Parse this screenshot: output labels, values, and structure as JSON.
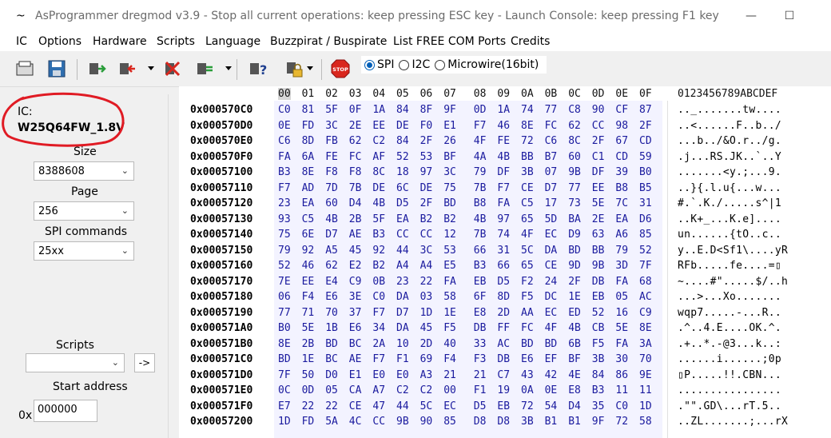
{
  "window": {
    "title": "AsProgrammer dregmod v3.9 - Stop all current operations: keep pressing ESC key - Launch Console: keep pressing F1 key",
    "app_icon": "~",
    "minimize": "—",
    "maximize": "☐"
  },
  "menu": [
    "IC",
    "Options",
    "Hardware",
    "Scripts",
    "Language",
    "Buzzpirat / Buspirate",
    "List FREE COM Ports",
    "Credits"
  ],
  "toolbar": {
    "icons": [
      "open-folder-icon",
      "save-icon",
      "read-chip-icon",
      "write-chip-icon",
      "erase-chip-icon",
      "verify-chip-icon",
      "read-id-icon",
      "lock-icon",
      "stop-icon"
    ],
    "stop_label": "STOP"
  },
  "protocol": {
    "options": [
      "SPI",
      "I2C",
      "Microwire(16bit)"
    ],
    "selected": "SPI"
  },
  "left": {
    "ic_label": "IC:",
    "ic_name": "W25Q64FW_1.8V",
    "size_label": "Size",
    "size_value": "8388608",
    "page_label": "Page",
    "page_value": "256",
    "spi_label": "SPI commands",
    "spi_value": "25xx",
    "scripts_label": "Scripts",
    "scripts_value": "",
    "run_button": "->",
    "start_label": "Start address",
    "start_prefix": "0x",
    "start_value": "000000"
  },
  "hex": {
    "columns": [
      "00",
      "01",
      "02",
      "03",
      "04",
      "05",
      "06",
      "07",
      "08",
      "09",
      "0A",
      "0B",
      "0C",
      "0D",
      "0E",
      "0F"
    ],
    "ascii_header": "0123456789ABCDEF",
    "rows": [
      {
        "addr": "0x000570C0",
        "bytes": [
          "C0",
          "81",
          "5F",
          "0F",
          "1A",
          "84",
          "8F",
          "9F",
          "0D",
          "1A",
          "74",
          "77",
          "C8",
          "90",
          "CF",
          "87"
        ],
        "ascii": ".._.......tw...."
      },
      {
        "addr": "0x000570D0",
        "bytes": [
          "0E",
          "FD",
          "3C",
          "2E",
          "EE",
          "DE",
          "F0",
          "E1",
          "F7",
          "46",
          "8E",
          "FC",
          "62",
          "CC",
          "98",
          "2F"
        ],
        "ascii": "..<......F..b../"
      },
      {
        "addr": "0x000570E0",
        "bytes": [
          "C6",
          "8D",
          "FB",
          "62",
          "C2",
          "84",
          "2F",
          "26",
          "4F",
          "FE",
          "72",
          "C6",
          "8C",
          "2F",
          "67",
          "CD"
        ],
        "ascii": "...b../&O.r../g."
      },
      {
        "addr": "0x000570F0",
        "bytes": [
          "FA",
          "6A",
          "FE",
          "FC",
          "AF",
          "52",
          "53",
          "BF",
          "4A",
          "4B",
          "BB",
          "B7",
          "60",
          "C1",
          "CD",
          "59"
        ],
        "ascii": ".j...RS.JK..`..Y"
      },
      {
        "addr": "0x00057100",
        "bytes": [
          "B3",
          "8E",
          "F8",
          "F8",
          "8C",
          "18",
          "97",
          "3C",
          "79",
          "DF",
          "3B",
          "07",
          "9B",
          "DF",
          "39",
          "B0"
        ],
        "ascii": ".......<y.;...9."
      },
      {
        "addr": "0x00057110",
        "bytes": [
          "F7",
          "AD",
          "7D",
          "7B",
          "DE",
          "6C",
          "DE",
          "75",
          "7B",
          "F7",
          "CE",
          "D7",
          "77",
          "EE",
          "B8",
          "B5"
        ],
        "ascii": "..}{.l.u{...w..."
      },
      {
        "addr": "0x00057120",
        "bytes": [
          "23",
          "EA",
          "60",
          "D4",
          "4B",
          "D5",
          "2F",
          "BD",
          "B8",
          "FA",
          "C5",
          "17",
          "73",
          "5E",
          "7C",
          "31"
        ],
        "ascii": "#.`.K./.....s^|1"
      },
      {
        "addr": "0x00057130",
        "bytes": [
          "93",
          "C5",
          "4B",
          "2B",
          "5F",
          "EA",
          "B2",
          "B2",
          "4B",
          "97",
          "65",
          "5D",
          "BA",
          "2E",
          "EA",
          "D6"
        ],
        "ascii": "..K+_...K.e]...."
      },
      {
        "addr": "0x00057140",
        "bytes": [
          "75",
          "6E",
          "D7",
          "AE",
          "B3",
          "CC",
          "CC",
          "12",
          "7B",
          "74",
          "4F",
          "EC",
          "D9",
          "63",
          "A6",
          "85"
        ],
        "ascii": "un......{tO..c.."
      },
      {
        "addr": "0x00057150",
        "bytes": [
          "79",
          "92",
          "A5",
          "45",
          "92",
          "44",
          "3C",
          "53",
          "66",
          "31",
          "5C",
          "DA",
          "BD",
          "BB",
          "79",
          "52"
        ],
        "ascii": "y..E.D<Sf1\\....yR"
      },
      {
        "addr": "0x00057160",
        "bytes": [
          "52",
          "46",
          "62",
          "E2",
          "B2",
          "A4",
          "A4",
          "E5",
          "B3",
          "66",
          "65",
          "CE",
          "9D",
          "9B",
          "3D",
          "7F"
        ],
        "ascii": "RFb.....fe....=▯"
      },
      {
        "addr": "0x00057170",
        "bytes": [
          "7E",
          "EE",
          "E4",
          "C9",
          "0B",
          "23",
          "22",
          "FA",
          "EB",
          "D5",
          "F2",
          "24",
          "2F",
          "DB",
          "FA",
          "68"
        ],
        "ascii": "~....#\".....$/..h"
      },
      {
        "addr": "0x00057180",
        "bytes": [
          "06",
          "F4",
          "E6",
          "3E",
          "C0",
          "DA",
          "03",
          "58",
          "6F",
          "8D",
          "F5",
          "DC",
          "1E",
          "EB",
          "05",
          "AC"
        ],
        "ascii": "...>...Xo......."
      },
      {
        "addr": "0x00057190",
        "bytes": [
          "77",
          "71",
          "70",
          "37",
          "F7",
          "D7",
          "1D",
          "1E",
          "E8",
          "2D",
          "AA",
          "EC",
          "ED",
          "52",
          "16",
          "C9"
        ],
        "ascii": "wqp7.....-...R.."
      },
      {
        "addr": "0x000571A0",
        "bytes": [
          "B0",
          "5E",
          "1B",
          "E6",
          "34",
          "DA",
          "45",
          "F5",
          "DB",
          "FF",
          "FC",
          "4F",
          "4B",
          "CB",
          "5E",
          "8E"
        ],
        "ascii": ".^..4.E....OK.^."
      },
      {
        "addr": "0x000571B0",
        "bytes": [
          "8E",
          "2B",
          "BD",
          "BC",
          "2A",
          "10",
          "2D",
          "40",
          "33",
          "AC",
          "BD",
          "BD",
          "6B",
          "F5",
          "FA",
          "3A"
        ],
        "ascii": ".+..*.-@3...k..:"
      },
      {
        "addr": "0x000571C0",
        "bytes": [
          "BD",
          "1E",
          "BC",
          "AE",
          "F7",
          "F1",
          "69",
          "F4",
          "F3",
          "DB",
          "E6",
          "EF",
          "BF",
          "3B",
          "30",
          "70"
        ],
        "ascii": "......i......;0p"
      },
      {
        "addr": "0x000571D0",
        "bytes": [
          "7F",
          "50",
          "D0",
          "E1",
          "E0",
          "E0",
          "A3",
          "21",
          "21",
          "C7",
          "43",
          "42",
          "4E",
          "84",
          "86",
          "9E"
        ],
        "ascii": "▯P.....!!.CBN..."
      },
      {
        "addr": "0x000571E0",
        "bytes": [
          "0C",
          "0D",
          "05",
          "CA",
          "A7",
          "C2",
          "C2",
          "00",
          "F1",
          "19",
          "0A",
          "0E",
          "E8",
          "B3",
          "11",
          "11"
        ],
        "ascii": "................"
      },
      {
        "addr": "0x000571F0",
        "bytes": [
          "E7",
          "22",
          "22",
          "CE",
          "47",
          "44",
          "5C",
          "EC",
          "D5",
          "EB",
          "72",
          "54",
          "D4",
          "35",
          "C0",
          "1D"
        ],
        "ascii": ".\"\".GD\\...rT.5.."
      },
      {
        "addr": "0x00057200",
        "bytes": [
          "1D",
          "FD",
          "5A",
          "4C",
          "CC",
          "9B",
          "90",
          "85",
          "D8",
          "D8",
          "3B",
          "B1",
          "B1",
          "9F",
          "72",
          "58"
        ],
        "ascii": "..ZL.......;...rX"
      }
    ]
  },
  "colors": {
    "hex_text": "#1a1a9e",
    "annotation_circle": "#e01b24",
    "selected_radio": "#005fb8",
    "stop_red": "#d9271e"
  }
}
